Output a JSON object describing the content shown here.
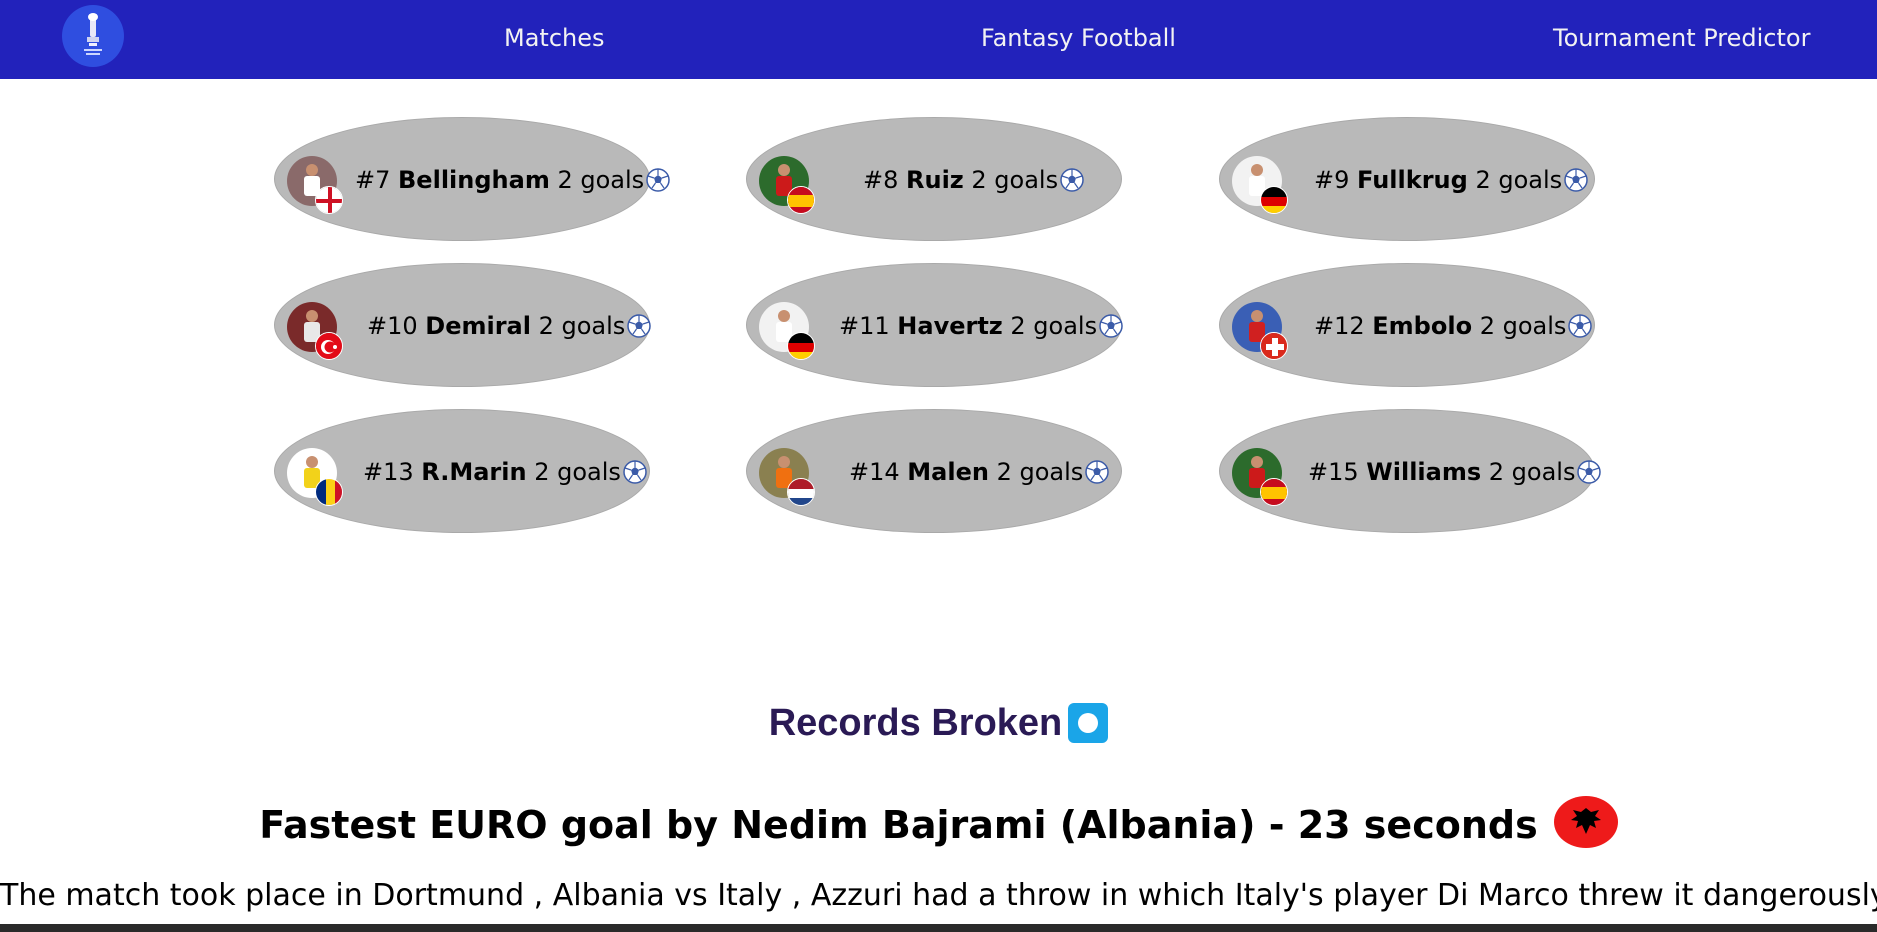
{
  "nav": {
    "logo_icon": "euro-2024-trophy-logo",
    "links": [
      "Matches",
      "Fantasy Football",
      "Tournament Predictor"
    ]
  },
  "scorers": [
    {
      "rank": "#7",
      "name": "Bellingham",
      "goals": "2 goals",
      "flag": "england",
      "flag_colors": [
        "#ffffff",
        "#ce1124"
      ]
    },
    {
      "rank": "#8",
      "name": "Ruiz",
      "goals": "2 goals",
      "flag": "spain",
      "flag_colors": [
        "#c60b1e",
        "#ffc400"
      ]
    },
    {
      "rank": "#9",
      "name": "Fullkrug",
      "goals": "2 goals",
      "flag": "germany",
      "flag_colors": [
        "#000000",
        "#dd0000",
        "#ffce00"
      ]
    },
    {
      "rank": "#10",
      "name": "Demiral",
      "goals": "2 goals",
      "flag": "turkey",
      "flag_colors": [
        "#e30a17",
        "#ffffff"
      ]
    },
    {
      "rank": "#11",
      "name": "Havertz",
      "goals": "2 goals",
      "flag": "germany",
      "flag_colors": [
        "#000000",
        "#dd0000",
        "#ffce00"
      ]
    },
    {
      "rank": "#12",
      "name": "Embolo",
      "goals": "2 goals",
      "flag": "switzerland",
      "flag_colors": [
        "#da291c",
        "#ffffff"
      ]
    },
    {
      "rank": "#13",
      "name": "R.Marin",
      "goals": "2 goals",
      "flag": "romania",
      "flag_colors": [
        "#002b7f",
        "#fcd116",
        "#ce1126"
      ]
    },
    {
      "rank": "#14",
      "name": "Malen",
      "goals": "2 goals",
      "flag": "netherlands",
      "flag_colors": [
        "#ae1c28",
        "#ffffff",
        "#21468b"
      ]
    },
    {
      "rank": "#15",
      "name": "Williams",
      "goals": "2 goals",
      "flag": "spain",
      "flag_colors": [
        "#c60b1e",
        "#ffc400"
      ]
    }
  ],
  "records": {
    "title": "Records Broken",
    "title_icon": "stop-button-icon",
    "headline": "Fastest EURO goal by Nedim Bajrami (Albania) - 23 seconds",
    "headline_icon": "albania-flag-icon",
    "description": "The match took place in Dortmund , Albania vs Italy , Azzuri had a throw in which Italy's player Di Marco threw it dangerously in"
  },
  "colors": {
    "nav_bg": "#2222bb",
    "card_bg": "#b9b9b9",
    "title_color": "#2a1a55",
    "albania_red": "#ee1a1a"
  }
}
